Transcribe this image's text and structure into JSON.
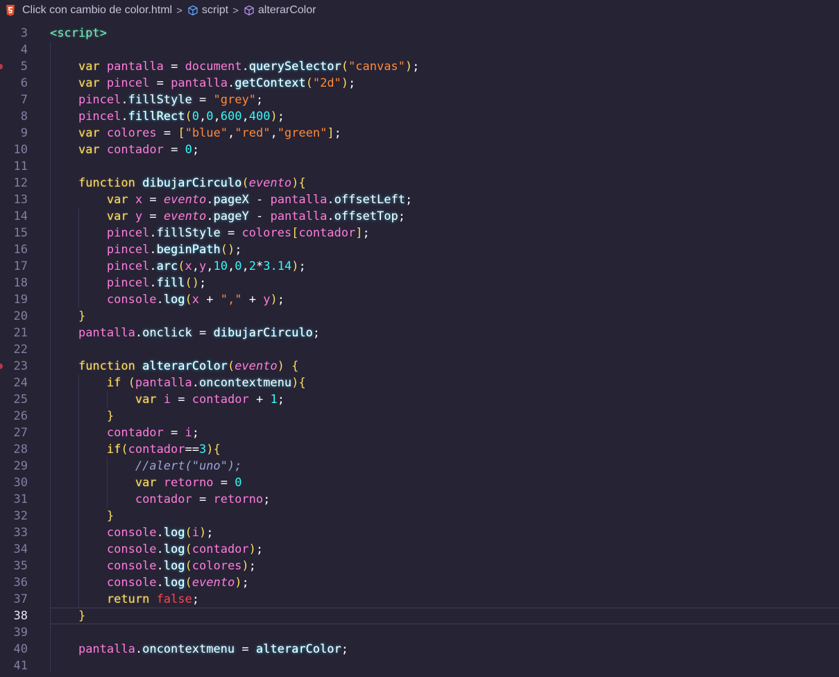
{
  "breadcrumb": {
    "file": "Click con cambio de color.html",
    "segment1": "script",
    "segment2": "alterarColor"
  },
  "colors": {
    "background": "#262335",
    "keyword": "#fede5d",
    "variable": "#ff7edb",
    "string": "#ff8b39",
    "number": "#f97e72",
    "tag": "#72f1b8"
  },
  "editor": {
    "current_line": 38,
    "lines": [
      {
        "n": "3",
        "t": "<script>"
      },
      {
        "n": "4",
        "t": ""
      },
      {
        "n": "5",
        "t": "    var pantalla = document.querySelector(\"canvas\");"
      },
      {
        "n": "6",
        "t": "    var pincel = pantalla.getContext(\"2d\");"
      },
      {
        "n": "7",
        "t": "    pincel.fillStyle = \"grey\";"
      },
      {
        "n": "8",
        "t": "    pincel.fillRect(0,0,600,400);"
      },
      {
        "n": "9",
        "t": "    var colores = [\"blue\",\"red\",\"green\"];"
      },
      {
        "n": "10",
        "t": "    var contador = 0;"
      },
      {
        "n": "11",
        "t": ""
      },
      {
        "n": "12",
        "t": "    function dibujarCirculo(evento){"
      },
      {
        "n": "13",
        "t": "        var x = evento.pageX - pantalla.offsetLeft;"
      },
      {
        "n": "14",
        "t": "        var y = evento.pageY - pantalla.offsetTop;"
      },
      {
        "n": "15",
        "t": "        pincel.fillStyle = colores[contador];"
      },
      {
        "n": "16",
        "t": "        pincel.beginPath();"
      },
      {
        "n": "17",
        "t": "        pincel.arc(x,y,10,0,2*3.14);"
      },
      {
        "n": "18",
        "t": "        pincel.fill();"
      },
      {
        "n": "19",
        "t": "        console.log(x + \",\" + y);"
      },
      {
        "n": "20",
        "t": "    }"
      },
      {
        "n": "21",
        "t": "    pantalla.onclick = dibujarCirculo;"
      },
      {
        "n": "22",
        "t": ""
      },
      {
        "n": "23",
        "t": "    function alterarColor(evento) {"
      },
      {
        "n": "24",
        "t": "        if (pantalla.oncontextmenu){"
      },
      {
        "n": "25",
        "t": "            var i = contador + 1;"
      },
      {
        "n": "26",
        "t": "        }"
      },
      {
        "n": "27",
        "t": "        contador = i;"
      },
      {
        "n": "28",
        "t": "        if(contador==3){"
      },
      {
        "n": "29",
        "t": "            //alert(\"uno\");"
      },
      {
        "n": "30",
        "t": "            var retorno = 0"
      },
      {
        "n": "31",
        "t": "            contador = retorno;"
      },
      {
        "n": "32",
        "t": "        }"
      },
      {
        "n": "33",
        "t": "        console.log(i);"
      },
      {
        "n": "34",
        "t": "        console.log(contador);"
      },
      {
        "n": "35",
        "t": "        console.log(colores);"
      },
      {
        "n": "36",
        "t": "        console.log(evento);"
      },
      {
        "n": "37",
        "t": "        return false;"
      },
      {
        "n": "38",
        "t": "    }"
      },
      {
        "n": "39",
        "t": ""
      },
      {
        "n": "40",
        "t": "    pantalla.oncontextmenu = alterarColor;"
      },
      {
        "n": "41",
        "t": ""
      }
    ]
  }
}
